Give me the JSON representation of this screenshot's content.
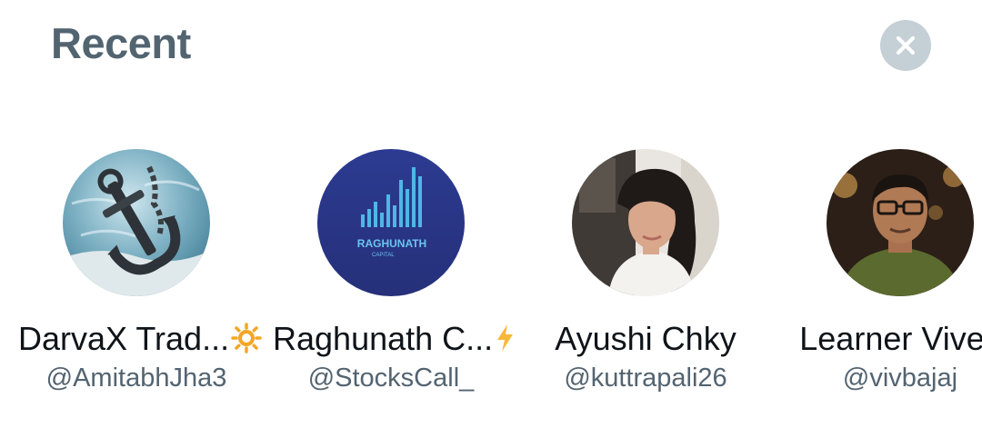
{
  "header": {
    "title": "Recent",
    "close_icon": "close-icon"
  },
  "accounts": [
    {
      "display_name": "DarvaX Trad...",
      "name_emoji": "sun-icon",
      "handle": "@AmitabhJha3",
      "avatar_icon": "anchor-underwater-avatar"
    },
    {
      "display_name": "Raghunath C...",
      "name_emoji": "lightning-icon",
      "handle": "@StocksCall_",
      "avatar_icon": "raghunath-capital-logo",
      "avatar_text": "RAGHUNATH",
      "avatar_subtext": "CAPITAL"
    },
    {
      "display_name": "Ayushi Chky",
      "handle": "@kuttrapali26",
      "avatar_icon": "woman-portrait-avatar"
    },
    {
      "display_name": "Learner Vivek",
      "handle": "@vivbajaj",
      "avatar_icon": "man-portrait-avatar"
    }
  ],
  "colors": {
    "title": "#536471",
    "text_primary": "#0f1419",
    "text_secondary": "#536471",
    "close_bg": "#c4cfd6",
    "emoji_sun": "#f4a623",
    "emoji_bolt": "#f6b93b"
  }
}
